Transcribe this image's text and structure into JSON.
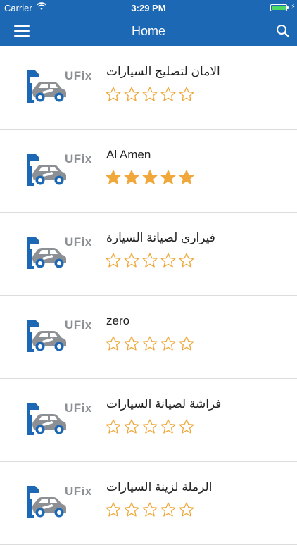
{
  "status_bar": {
    "carrier": "Carrier",
    "time": "3:29 PM"
  },
  "navbar": {
    "title": "Home",
    "menu_icon": "hamburger-menu-icon",
    "search_icon": "search-icon"
  },
  "colors": {
    "primary": "#1d68b4",
    "star": "#f0a83a",
    "logo_blue": "#1d68b4",
    "logo_gray": "#8c9094"
  },
  "logo": {
    "text": "UFix"
  },
  "shops": [
    {
      "name": "الامان لتصليح السيارات",
      "rating": 0,
      "max": 5
    },
    {
      "name": "Al Amen",
      "rating": 5,
      "max": 5
    },
    {
      "name": "فيراري لصيانة السيارة",
      "rating": 0,
      "max": 5
    },
    {
      "name": "zero",
      "rating": 0,
      "max": 5
    },
    {
      "name": "فراشة لصيانة السيارات",
      "rating": 0,
      "max": 5
    },
    {
      "name": "الرملة لزينة السيارات",
      "rating": 0,
      "max": 5
    }
  ]
}
